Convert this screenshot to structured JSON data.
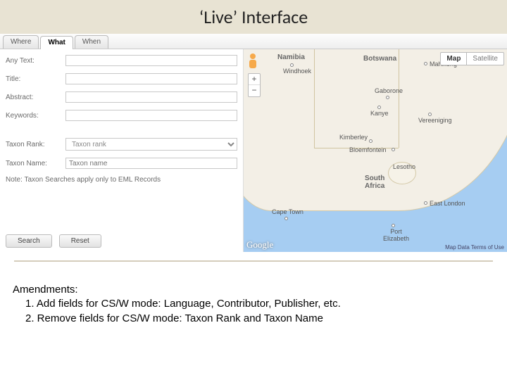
{
  "title": "‘Live’ Interface",
  "tabs": {
    "where": "Where",
    "what": "What",
    "when": "When"
  },
  "form": {
    "anytext": "Any Text:",
    "title": "Title:",
    "abstract": "Abstract:",
    "keywords": "Keywords:",
    "taxonrank": "Taxon Rank:",
    "taxonrank_ph": "Taxon rank",
    "taxonname": "Taxon Name:",
    "taxonname_ph": "Taxon name",
    "note": "Note: Taxon Searches apply only to EML Records"
  },
  "buttons": {
    "search": "Search",
    "reset": "Reset"
  },
  "map": {
    "maptype_map": "Map",
    "maptype_sat": "Satellite",
    "zoom_in": "+",
    "zoom_out": "−",
    "google": "Google",
    "terms": "Map Data   Terms of Use",
    "countries": {
      "namibia": "Namibia",
      "botswana": "Botswana",
      "southafrica": "South\nAfrica",
      "lesotho": "Lesotho"
    },
    "cities": {
      "windhoek": "Windhoek",
      "gaborone": "Gaborone",
      "kanye": "Kanye",
      "mahikeng": "Mahikeng",
      "vereeniging": "Vereeniging",
      "bloemfontein": "Bloemfontein",
      "kimberley": "Kimberley",
      "eastlondon": "East London",
      "pe": "Port\nElizabeth",
      "capetown": "Cape Town"
    }
  },
  "amend": {
    "heading": "Amendments:",
    "item1": "1.  Add fields for CS/W mode: Language, Contributor, Publisher, etc.",
    "item2": "2.  Remove fields for CS/W mode: Taxon Rank and Taxon Name"
  }
}
